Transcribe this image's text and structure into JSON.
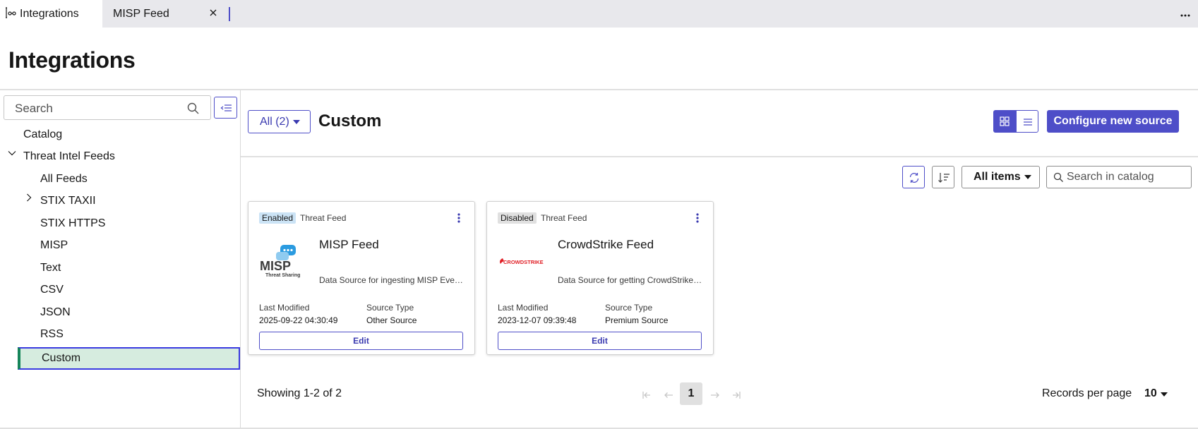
{
  "tabs": [
    {
      "label": "Integrations",
      "icon": "integrations-icon",
      "active": true
    },
    {
      "label": "MISP Feed",
      "icon": "close-icon",
      "active": false
    }
  ],
  "page_title": "Integrations",
  "sidebar": {
    "search_placeholder": "Search",
    "items": [
      {
        "label": "Catalog"
      },
      {
        "label": "Threat Intel Feeds",
        "expanded": true
      },
      {
        "label": "All Feeds"
      },
      {
        "label": "STIX TAXII",
        "expandable": true
      },
      {
        "label": "STIX HTTPS"
      },
      {
        "label": "MISP"
      },
      {
        "label": "Text"
      },
      {
        "label": "CSV"
      },
      {
        "label": "JSON"
      },
      {
        "label": "RSS"
      },
      {
        "label": "Custom",
        "selected": true
      }
    ]
  },
  "main": {
    "filter_label": "All (2)",
    "section_title": "Custom",
    "configure_label": "Configure new source",
    "all_items_label": "All items",
    "catalog_search_placeholder": "Search in catalog"
  },
  "cards": [
    {
      "status": "Enabled",
      "type": "Threat Feed",
      "name": "MISP Feed",
      "logo_title": "MISP",
      "logo_subtitle": "Threat Sharing",
      "description": "Data Source for ingesting MISP Events",
      "last_modified_label": "Last Modified",
      "last_modified": "2025-09-22 04:30:49",
      "source_type_label": "Source Type",
      "source_type": "Other Source",
      "edit_label": "Edit"
    },
    {
      "status": "Disabled",
      "type": "Threat Feed",
      "name": "CrowdStrike Feed",
      "logo_title": "CROWDSTRIKE",
      "description": "Data Source for getting CrowdStrike indicators",
      "last_modified_label": "Last Modified",
      "last_modified": "2023-12-07 09:39:48",
      "source_type_label": "Source Type",
      "source_type": "Premium Source",
      "edit_label": "Edit"
    }
  ],
  "pagination": {
    "showing": "Showing 1-2 of 2",
    "current_page": "1",
    "records_label": "Records per page",
    "records_value": "10"
  },
  "colors": {
    "accent": "#4e4ec8",
    "selected_bg": "#d6ecdf",
    "selected_marker": "#16855a",
    "enabled_badge": "#cbe3f5",
    "crowdstrike_red": "#e01f26"
  }
}
